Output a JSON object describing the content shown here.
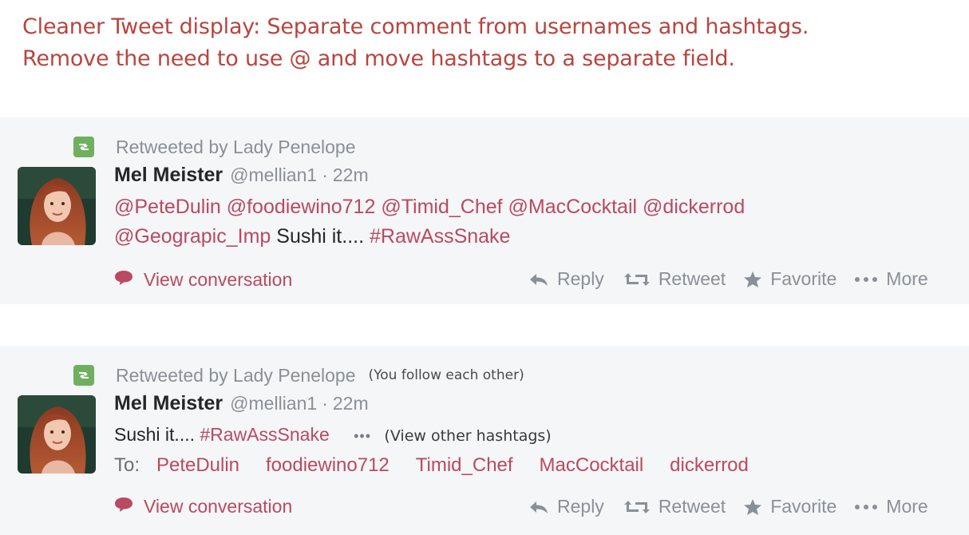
{
  "headline": {
    "line1": "Cleaner Tweet display: Separate comment from usernames and hashtags.",
    "line2": "Remove the need to use @ and move hashtags to a separate field."
  },
  "colors": {
    "headline": "#b8453f",
    "link": "#b94a62",
    "meta": "#8a9097",
    "retweet_icon": "#6fb05f",
    "panel": "#f5f6f7"
  },
  "tweets": [
    {
      "retweeted_by": "Retweeted by Lady Penelope",
      "name": "Mel Meister",
      "handle": "@mellian1",
      "separator": "·",
      "time": "22m",
      "mentions_line1": [
        "@PeteDulin",
        "@foodiewino712",
        "@Timid_Chef",
        "@MacCocktail",
        "@dickerrod"
      ],
      "mention_line2": "@Geograpic_Imp",
      "comment": "Sushi it....",
      "hashtag": "#RawAssSnake",
      "view_conversation": "View conversation",
      "actions": {
        "reply": "Reply",
        "retweet": "Retweet",
        "favorite": "Favorite",
        "more": "More"
      }
    },
    {
      "retweeted_by": "Retweeted by Lady Penelope",
      "follow_note": "(You follow each other)",
      "name": "Mel Meister",
      "handle": "@mellian1",
      "separator": "·",
      "time": "22m",
      "comment": "Sushi it....",
      "hashtag": "#RawAssSnake",
      "ellipsis": "•••",
      "view_other_hashtags": "(View other hashtags)",
      "to_label": "To:",
      "to_names": [
        "PeteDulin",
        "foodiewino712",
        "Timid_Chef",
        "MacCocktail",
        "dickerrod"
      ],
      "view_conversation": "View conversation",
      "actions": {
        "reply": "Reply",
        "retweet": "Retweet",
        "favorite": "Favorite",
        "more": "More"
      }
    }
  ],
  "icons": {
    "retweet": "retweet-icon",
    "conversation": "speech-bubble-icon",
    "reply": "reply-arrow-icon",
    "favorite": "star-icon",
    "more": "ellipsis-icon"
  }
}
